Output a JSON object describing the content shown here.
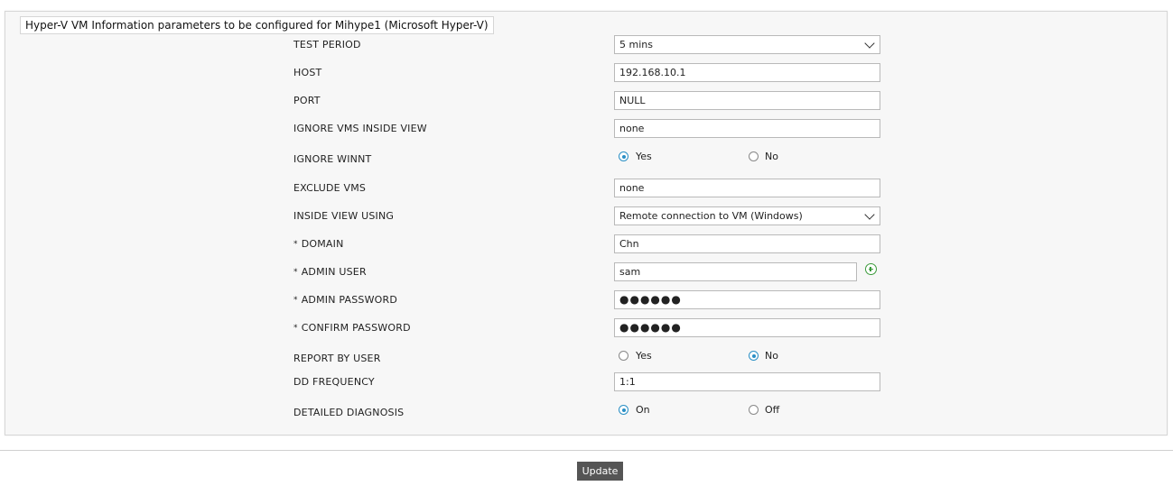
{
  "panel": {
    "title": "Hyper-V VM Information parameters to be configured for Mihype1 (Microsoft Hyper-V)"
  },
  "fields": {
    "test_period": {
      "label": "TEST PERIOD",
      "value": "5 mins"
    },
    "host": {
      "label": "HOST",
      "value": "192.168.10.1"
    },
    "port": {
      "label": "PORT",
      "value": "NULL"
    },
    "ignore_vms_inside_view": {
      "label": "IGNORE VMS INSIDE VIEW",
      "value": "none"
    },
    "ignore_winnt": {
      "label": "IGNORE WINNT",
      "option_yes": "Yes",
      "option_no": "No",
      "selected": "Yes"
    },
    "exclude_vms": {
      "label": "EXCLUDE VMS",
      "value": "none"
    },
    "inside_view_using": {
      "label": "INSIDE VIEW USING",
      "value": "Remote connection to VM (Windows)"
    },
    "domain": {
      "required_mark": "*",
      "label": "DOMAIN",
      "value": "Chn"
    },
    "admin_user": {
      "required_mark": "*",
      "label": "ADMIN USER",
      "value": "sam"
    },
    "admin_password": {
      "required_mark": "*",
      "label": "ADMIN PASSWORD",
      "value": "●●●●●●"
    },
    "confirm_password": {
      "required_mark": "*",
      "label": "CONFIRM PASSWORD",
      "value": "●●●●●●"
    },
    "report_by_user": {
      "label": "REPORT BY USER",
      "option_yes": "Yes",
      "option_no": "No",
      "selected": "No"
    },
    "dd_frequency": {
      "label": "DD FREQUENCY",
      "value": "1:1"
    },
    "detailed_diagnosis": {
      "label": "DETAILED DIAGNOSIS",
      "option_on": "On",
      "option_off": "Off",
      "selected": "On"
    }
  },
  "icons": {
    "add_user": "add-circle-icon",
    "dropdown": "chevron-down-icon"
  },
  "colors": {
    "radio_selected": "#2a8fc5",
    "add_icon": "#3a9a3a",
    "update_button_bg": "#555555",
    "panel_bg": "#f7f7f7"
  },
  "actions": {
    "update_label": "Update"
  }
}
